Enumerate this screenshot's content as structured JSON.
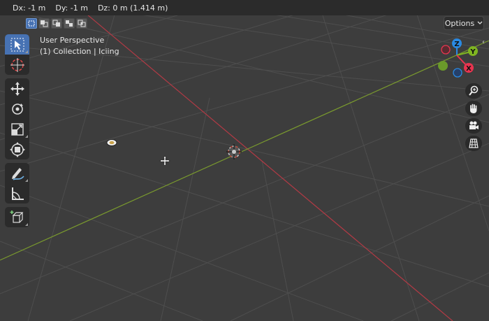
{
  "header": {
    "dx": "Dx: -1 m",
    "dy": "Dy: -1 m",
    "dz": "Dz: 0 m (1.414 m)"
  },
  "options": {
    "label": "Options",
    "icon": "chevron-down-icon"
  },
  "overlay": {
    "view_name": "User Perspective",
    "collection": "(1) Collection | Iciing"
  },
  "select_modes": [
    {
      "icon": "select-new-icon",
      "active": true
    },
    {
      "icon": "select-extend-icon",
      "active": false
    },
    {
      "icon": "select-subtract-icon",
      "active": false
    },
    {
      "icon": "select-invert-icon",
      "active": false
    },
    {
      "icon": "select-intersect-icon",
      "active": false
    }
  ],
  "tools": [
    {
      "icon": "select-box-icon",
      "active": true
    },
    {
      "icon": "cursor-icon",
      "active": false
    },
    {
      "icon": "move-icon",
      "active": false
    },
    {
      "icon": "rotate-icon",
      "active": false
    },
    {
      "icon": "scale-icon",
      "active": false
    },
    {
      "icon": "transform-icon",
      "active": false
    },
    {
      "icon": "annotate-icon",
      "active": false
    },
    {
      "icon": "measure-icon",
      "active": false
    },
    {
      "icon": "add-cube-icon",
      "active": false
    }
  ],
  "gizmo": {
    "z_label": "Z",
    "y_label": "Y",
    "x_label": "X",
    "colors": {
      "x": "#e8344f",
      "y": "#7fb521",
      "z": "#2a8ae3"
    }
  },
  "nav_buttons": [
    "zoom-icon",
    "hand-pan-icon",
    "camera-icon",
    "grid-ortho-icon"
  ],
  "colors": {
    "background": "#3d3d3d",
    "header": "#2b2b2b",
    "accent": "#4772b3",
    "x_axis": "#b33a45",
    "y_axis": "#7a9a2e"
  }
}
